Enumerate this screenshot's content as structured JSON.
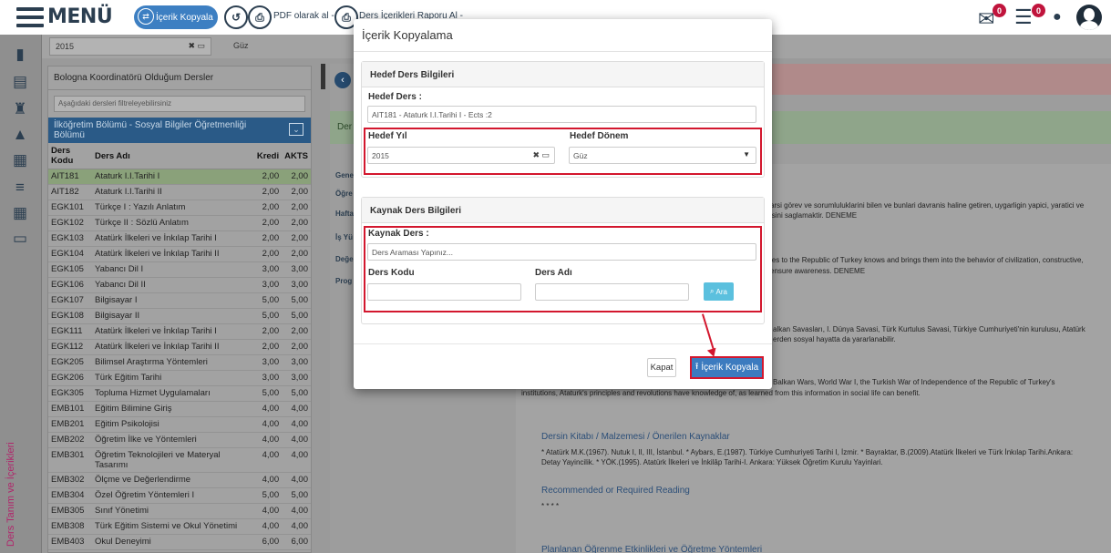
{
  "topbar": {
    "menu_label": "MENÜ",
    "copy_content": "İçerik Kopyala",
    "pdf_label": "PDF olarak al -",
    "report_label": "Ders İçerikleri Raporu Al -",
    "mail_badge": "0",
    "list_badge": "0"
  },
  "filters": {
    "year": "2015",
    "term": "Güz"
  },
  "course_panel": {
    "title": "Bologna Koordinatörü Olduğum Dersler",
    "filter_placeholder": "Aşağıdaki dersleri filtreleyebilirsiniz",
    "department": "İlköğretim Bölümü - Sosyal Bilgiler Öğretmenliği Bölümü",
    "headers": [
      "Ders Kodu",
      "Ders Adı",
      "Kredi",
      "AKTS"
    ],
    "rows": [
      {
        "code": "AIT181",
        "name": "Ataturk I.I.Tarihi I",
        "kredi": "2,00",
        "akts": "2,00"
      },
      {
        "code": "AIT182",
        "name": "Ataturk I.I.Tarihi II",
        "kredi": "2,00",
        "akts": "2,00"
      },
      {
        "code": "EGK101",
        "name": "Türkçe I : Yazılı Anlatım",
        "kredi": "2,00",
        "akts": "2,00"
      },
      {
        "code": "EGK102",
        "name": "Türkçe II : Sözlü Anlatım",
        "kredi": "2,00",
        "akts": "2,00"
      },
      {
        "code": "EGK103",
        "name": "Atatürk İlkeleri ve İnkılap Tarihi I",
        "kredi": "2,00",
        "akts": "2,00"
      },
      {
        "code": "EGK104",
        "name": "Atatürk İlkeleri ve İnkılap Tarihi II",
        "kredi": "2,00",
        "akts": "2,00"
      },
      {
        "code": "EGK105",
        "name": "Yabancı Dil I",
        "kredi": "3,00",
        "akts": "3,00"
      },
      {
        "code": "EGK106",
        "name": "Yabancı Dil II",
        "kredi": "3,00",
        "akts": "3,00"
      },
      {
        "code": "EGK107",
        "name": "Bilgisayar I",
        "kredi": "5,00",
        "akts": "5,00"
      },
      {
        "code": "EGK108",
        "name": "Bilgisayar II",
        "kredi": "5,00",
        "akts": "5,00"
      },
      {
        "code": "EGK111",
        "name": "Atatürk İlkeleri ve İnkılap Tarihi I",
        "kredi": "2,00",
        "akts": "2,00"
      },
      {
        "code": "EGK112",
        "name": "Atatürk İlkeleri ve İnkılap Tarihi II",
        "kredi": "2,00",
        "akts": "2,00"
      },
      {
        "code": "EGK205",
        "name": "Bilimsel Araştırma Yöntemleri",
        "kredi": "3,00",
        "akts": "3,00"
      },
      {
        "code": "EGK206",
        "name": "Türk Eğitim Tarihi",
        "kredi": "3,00",
        "akts": "3,00"
      },
      {
        "code": "EGK305",
        "name": "Topluma Hizmet Uygulamaları",
        "kredi": "5,00",
        "akts": "5,00"
      },
      {
        "code": "EMB101",
        "name": "Eğitim Bilimine Giriş",
        "kredi": "4,00",
        "akts": "4,00"
      },
      {
        "code": "EMB201",
        "name": "Eğitim Psikolojisi",
        "kredi": "4,00",
        "akts": "4,00"
      },
      {
        "code": "EMB202",
        "name": "Öğretim İlke ve Yöntemleri",
        "kredi": "4,00",
        "akts": "4,00"
      },
      {
        "code": "EMB301",
        "name": "Öğretim Teknolojileri ve Materyal Tasarımı",
        "kredi": "4,00",
        "akts": "4,00"
      },
      {
        "code": "EMB302",
        "name": "Ölçme ve Değerlendirme",
        "kredi": "4,00",
        "akts": "4,00"
      },
      {
        "code": "EMB304",
        "name": "Özel Öğretim Yöntemleri I",
        "kredi": "5,00",
        "akts": "5,00"
      },
      {
        "code": "EMB305",
        "name": "Sınıf Yönetimi",
        "kredi": "4,00",
        "akts": "4,00"
      },
      {
        "code": "EMB308",
        "name": "Türk Eğitim Sistemi ve Okul Yönetimi",
        "kredi": "4,00",
        "akts": "4,00"
      },
      {
        "code": "EMB403",
        "name": "Okul Deneyimi",
        "kredi": "6,00",
        "akts": "6,00"
      }
    ]
  },
  "sidebar_vertical_label": "Ders Tanım ve İçerikleri",
  "background": {
    "green_label": "Der",
    "tabs": [
      "Gene",
      "Öğre",
      "Hafta",
      "İş Yü",
      "Değe",
      "Prog"
    ],
    "text1": "arsi görev ve sorumluluklarini bilen ve bunlari davranis haline getiren, uygarligin yapici, yaratici ve",
    "text1b": "isini saglamaktir. DENEME",
    "text2": "les to the Republic of Turkey knows and brings them into the behavior of civilization, constructive,",
    "text2b": "ensure awareness. DENEME",
    "text3": "alkan Savasları, I. Dünya Savasi, Türk Kurtulus Savasi, Türkiye Cumhuriyeti'nin kurulusu, Atatürk",
    "text3b": "erden sosyal hayatta da yararlanabilir.",
    "text4": "Balkan Wars, World War I, the Turkish War of Independence of the Republic of Turkey's",
    "text4b": "institutions, Ataturk's principles and revolutions have knowledge of, as learned from this information in social life can benefit.",
    "head_books": "Dersin Kitabı / Malzemesi / Önerilen Kaynaklar",
    "books1": "* Atatürk M.K.(1967). Nutuk I, II, III, İstanbul. * Aybars, E.(1987). Türkiye Cumhuriyeti Tarihi I, İzmir. * Bayraktar, B.(2009).Atatürk İlkeleri ve Türk İnkılap Tarihi.Ankara:",
    "books2": "Detay Yayincilik. * YÖK.(1995). Atatürk İlkeleri ve İnkilâp Tarihi-I. Ankara: Yüksek Öğretim Kurulu Yayinlari.",
    "head_recommended": "Recommended or Required Reading",
    "recommended_text": "* * * *",
    "head_planned": "Planlanan Öğrenme Etkinlikleri ve Öğretme Yöntemleri"
  },
  "modal": {
    "title": "İçerik Kopyalama",
    "target_section": "Hedef Ders Bilgileri",
    "target_course_label": "Hedef Ders :",
    "target_course_value": "AIT181 - Ataturk I.I.Tarihi I - Ects :2",
    "target_year_label": "Hedef Yıl",
    "target_year_value": "2015",
    "target_term_label": "Hedef Dönem",
    "target_term_value": "Güz",
    "source_section": "Kaynak Ders Bilgileri",
    "source_course_label": "Kaynak Ders :",
    "source_course_placeholder": "Ders Araması Yapınız...",
    "code_label": "Ders Kodu",
    "name_label": "Ders Adı",
    "search_button": "Ara",
    "close_button": "Kapat",
    "copy_button": "İçerik Kopyala"
  },
  "colors": {
    "highlight": "#d3172e",
    "primary": "#3c7bbf",
    "info": "#5bc0de"
  }
}
